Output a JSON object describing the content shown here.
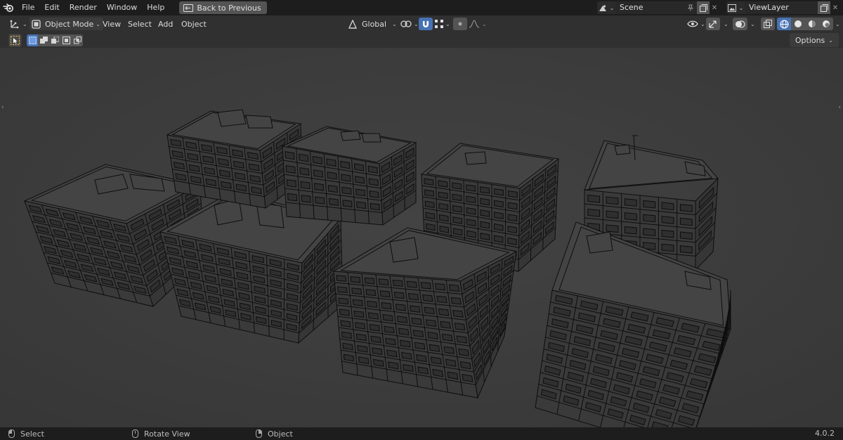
{
  "menu": {
    "items": [
      "File",
      "Edit",
      "Render",
      "Window",
      "Help"
    ],
    "back_button": "Back to Previous"
  },
  "scene": {
    "name": "Scene",
    "icon": "scene-icon"
  },
  "view_layer": {
    "name": "ViewLayer",
    "icon": "view-layer-icon"
  },
  "header": {
    "mode": "Object Mode",
    "menus": [
      "View",
      "Select",
      "Add",
      "Object"
    ],
    "transform_orientation": "Global",
    "options_label": "Options"
  },
  "status": {
    "left_click": "Select",
    "middle_click": "Rotate View",
    "right_click": "Object",
    "version": "4.0.2"
  },
  "colors": {
    "accent": "#4772b3",
    "topbar": "#1d1d1d",
    "viewport": "#3d3d3d",
    "wire": "#0e0e0e"
  }
}
